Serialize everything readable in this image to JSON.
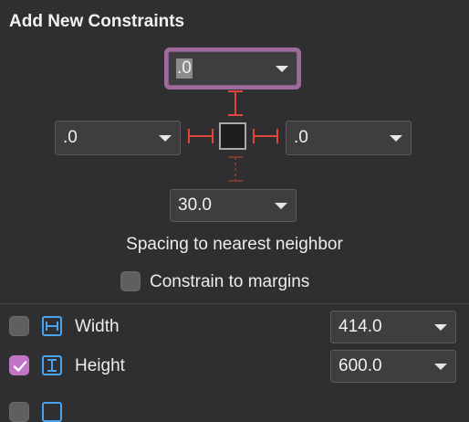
{
  "panel": {
    "title": "Add New Constraints"
  },
  "spacing": {
    "top": {
      "value": ".0"
    },
    "left": {
      "value": ".0"
    },
    "right": {
      "value": ".0"
    },
    "bottom": {
      "value": "30.0"
    },
    "caption": "Spacing to nearest neighbor"
  },
  "margins": {
    "label": "Constrain to margins",
    "checked": false
  },
  "width": {
    "label": "Width",
    "checked": false,
    "value": "414.0"
  },
  "height": {
    "label": "Height",
    "checked": true,
    "value": "600.0"
  },
  "colors": {
    "accent": "#c274c7",
    "strut": "#e0463c",
    "icon": "#4aa3f0"
  }
}
